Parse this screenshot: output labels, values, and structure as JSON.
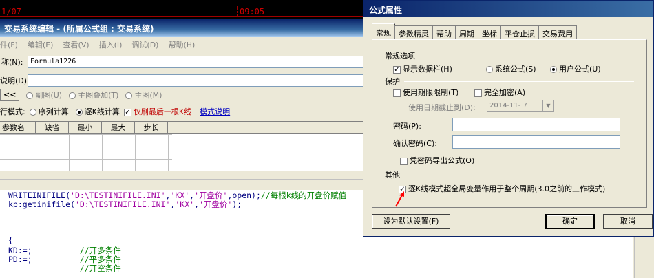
{
  "chart": {
    "date": "1/07",
    "time": "09:05"
  },
  "editor": {
    "title": "交易系统编辑 - (所属公式组 : 交易系统)",
    "menu": [
      "件(F)",
      "编辑(E)",
      "查看(V)",
      "插入(I)",
      "调试(D)",
      "帮助(H)"
    ],
    "name_label": "称(N):",
    "name_value": "Formula1226",
    "desc_label": "说明(D):",
    "desc_value": "",
    "prev_button": "<<",
    "chart_radios": [
      "副图(U)",
      "主图叠加(T)",
      "主图(M)"
    ],
    "mode_label": "行模式:",
    "mode_options": [
      "序列计算",
      "逐K线计算"
    ],
    "mode_selected": 1,
    "refresh_last_label": "仅刷最后一根K线",
    "refresh_last_checked": true,
    "mode_help_link": "模式说明",
    "param_headers": [
      "参数名",
      "缺省",
      "最小",
      "最大",
      "步长"
    ],
    "code_lines": [
      {
        "segments": [
          [
            "WRITEINIFILE(",
            "fn"
          ],
          [
            "'D:\\TESTINIFILE.INI'",
            "str"
          ],
          [
            ",",
            "fn"
          ],
          [
            "'KX'",
            "str"
          ],
          [
            ",",
            "fn"
          ],
          [
            "'开盘价'",
            "str"
          ],
          [
            ",open);",
            "fn"
          ],
          [
            "//每根k线的开盘价赋值",
            "cm"
          ]
        ]
      },
      {
        "segments": [
          [
            "kp:getinifile(",
            "fn"
          ],
          [
            "'D:\\TESTINIFILE.INI'",
            "str"
          ],
          [
            ",",
            "fn"
          ],
          [
            "'KX'",
            "str"
          ],
          [
            ",",
            "fn"
          ],
          [
            "'开盘价'",
            "str"
          ],
          [
            ");",
            "fn"
          ]
        ]
      },
      {
        "segments": [
          [
            "",
            "fn"
          ]
        ]
      },
      {
        "segments": [
          [
            "",
            "fn"
          ]
        ]
      },
      {
        "segments": [
          [
            "{",
            "fn"
          ]
        ]
      },
      {
        "segments": [
          [
            "KD:=;          ",
            "fn"
          ],
          [
            "//开多条件",
            "cm"
          ]
        ]
      },
      {
        "segments": [
          [
            "PD:=;          ",
            "fn"
          ],
          [
            "//平多条件",
            "cm"
          ]
        ]
      },
      {
        "segments": [
          [
            "               ",
            "fn"
          ],
          [
            "//开空条件",
            "cm"
          ]
        ]
      }
    ]
  },
  "dialog": {
    "title": "公式属性",
    "tabs": [
      "常规",
      "参数精灵",
      "帮助",
      "周期",
      "坐标",
      "平仓止损",
      "交易费用"
    ],
    "active_tab": 0,
    "group_general": "常规选项",
    "show_data_bar": "显示数据栏(H)",
    "show_data_bar_checked": true,
    "formula_type_options": [
      "系统公式(S)",
      "用户公式(U)"
    ],
    "formula_type_selected": 1,
    "group_protect": "保护",
    "use_time_limit": "使用期限限制(T)",
    "use_time_limit_checked": false,
    "full_encrypt": "完全加密(A)",
    "full_encrypt_checked": false,
    "expire_label": "使用日期截止到(D):",
    "expire_value": "2014-11- 7",
    "password_label": "密码(P):",
    "password_value": "",
    "confirm_label": "确认密码(C):",
    "confirm_value": "",
    "export_with_pwd": "凭密码导出公式(O)",
    "export_with_pwd_checked": false,
    "group_other": "其他",
    "kline_global": "逐K线模式超全局变量作用于整个周期(3.0之前的工作模式)",
    "kline_global_checked": true,
    "set_default_button": "设为默认设置(F)",
    "ok_button": "确定",
    "cancel_button": "取消"
  },
  "colors": {
    "title_bar": "#0a246a",
    "annotation_arrow": "#ff0000",
    "chart_red": "#d00000"
  }
}
